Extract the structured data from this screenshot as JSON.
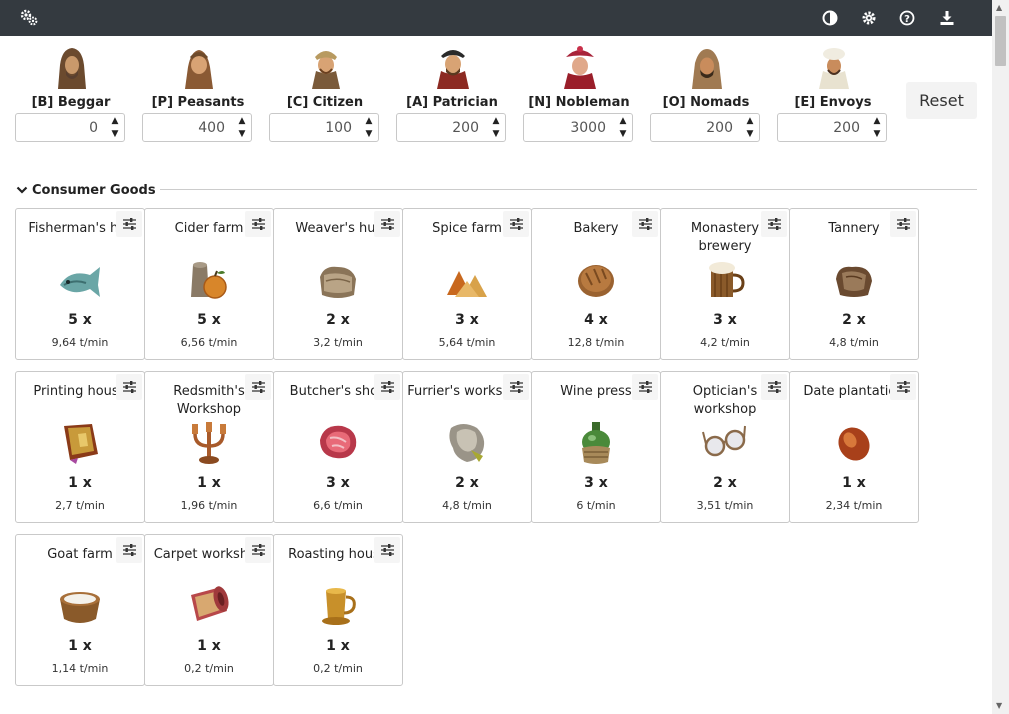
{
  "navbar": {
    "left_icon": "gears-icon",
    "right_icons": [
      "contrast-icon",
      "settings-icon",
      "help-icon",
      "download-icon"
    ]
  },
  "population": [
    {
      "label": "[B] Beggar",
      "value": "0",
      "icon": "beggar-portrait"
    },
    {
      "label": "[P] Peasants",
      "value": "400",
      "icon": "peasant-portrait"
    },
    {
      "label": "[C] Citizen",
      "value": "100",
      "icon": "citizen-portrait"
    },
    {
      "label": "[A] Patrician",
      "value": "200",
      "icon": "patrician-portrait"
    },
    {
      "label": "[N] Nobleman",
      "value": "3000",
      "icon": "nobleman-portrait"
    },
    {
      "label": "[O] Nomads",
      "value": "200",
      "icon": "nomad-portrait"
    },
    {
      "label": "[E] Envoys",
      "value": "200",
      "icon": "envoy-portrait"
    }
  ],
  "reset_label": "Reset",
  "section": {
    "title": "Consumer Goods",
    "icon": "chevron-down-icon"
  },
  "goods": [
    {
      "name": "Fisherman's hut",
      "count": "5 x",
      "rate": "9,64 t/min",
      "icon": "fish-icon"
    },
    {
      "name": "Cider farm",
      "count": "5 x",
      "rate": "6,56 t/min",
      "icon": "cider-icon"
    },
    {
      "name": "Weaver's hut",
      "count": "2 x",
      "rate": "3,2 t/min",
      "icon": "cloth-icon"
    },
    {
      "name": "Spice farm",
      "count": "3 x",
      "rate": "5,64 t/min",
      "icon": "spices-icon"
    },
    {
      "name": "Bakery",
      "count": "4 x",
      "rate": "12,8 t/min",
      "icon": "bread-icon"
    },
    {
      "name": "Monastery brewery",
      "count": "3 x",
      "rate": "4,2 t/min",
      "icon": "beer-icon"
    },
    {
      "name": "Tannery",
      "count": "2 x",
      "rate": "4,8 t/min",
      "icon": "leather-icon"
    },
    {
      "name": "Printing house",
      "count": "1 x",
      "rate": "2,7 t/min",
      "icon": "book-icon"
    },
    {
      "name": "Redsmith's Workshop",
      "count": "1 x",
      "rate": "1,96 t/min",
      "icon": "candlestick-icon"
    },
    {
      "name": "Butcher's shop",
      "count": "3 x",
      "rate": "6,6 t/min",
      "icon": "meat-icon"
    },
    {
      "name": "Furrier's workshop",
      "count": "2 x",
      "rate": "4,8 t/min",
      "icon": "fur-icon"
    },
    {
      "name": "Wine press",
      "count": "3 x",
      "rate": "6 t/min",
      "icon": "wine-icon"
    },
    {
      "name": "Optician's workshop",
      "count": "2 x",
      "rate": "3,51 t/min",
      "icon": "glasses-icon"
    },
    {
      "name": "Date plantation",
      "count": "1 x",
      "rate": "2,34 t/min",
      "icon": "dates-icon"
    },
    {
      "name": "Goat farm",
      "count": "1 x",
      "rate": "1,14 t/min",
      "icon": "milk-icon"
    },
    {
      "name": "Carpet workshop",
      "count": "1 x",
      "rate": "0,2 t/min",
      "icon": "carpet-icon"
    },
    {
      "name": "Roasting house",
      "count": "1 x",
      "rate": "0,2 t/min",
      "icon": "coffee-icon"
    }
  ]
}
